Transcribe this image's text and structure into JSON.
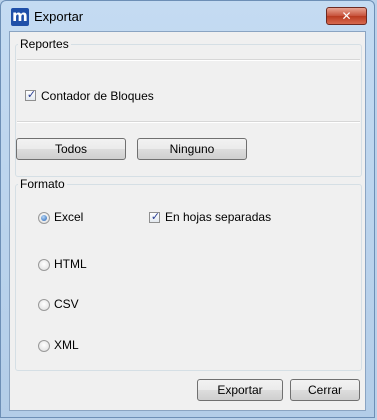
{
  "window": {
    "title": "Exportar",
    "app_icon_letter": "m",
    "close_glyph": "✕"
  },
  "reportes": {
    "legend": "Reportes",
    "items": [
      {
        "label": "Contador de Bloques",
        "checked": true
      }
    ],
    "buttons": {
      "all": "Todos",
      "none": "Ninguno"
    }
  },
  "formato": {
    "legend": "Formato",
    "options": [
      {
        "label": "Excel",
        "selected": true
      },
      {
        "label": "HTML",
        "selected": false
      },
      {
        "label": "CSV",
        "selected": false
      },
      {
        "label": "XML",
        "selected": false
      }
    ],
    "separate_sheets": {
      "label": "En hojas separadas",
      "checked": true
    }
  },
  "footer": {
    "export": "Exportar",
    "close": "Cerrar"
  }
}
